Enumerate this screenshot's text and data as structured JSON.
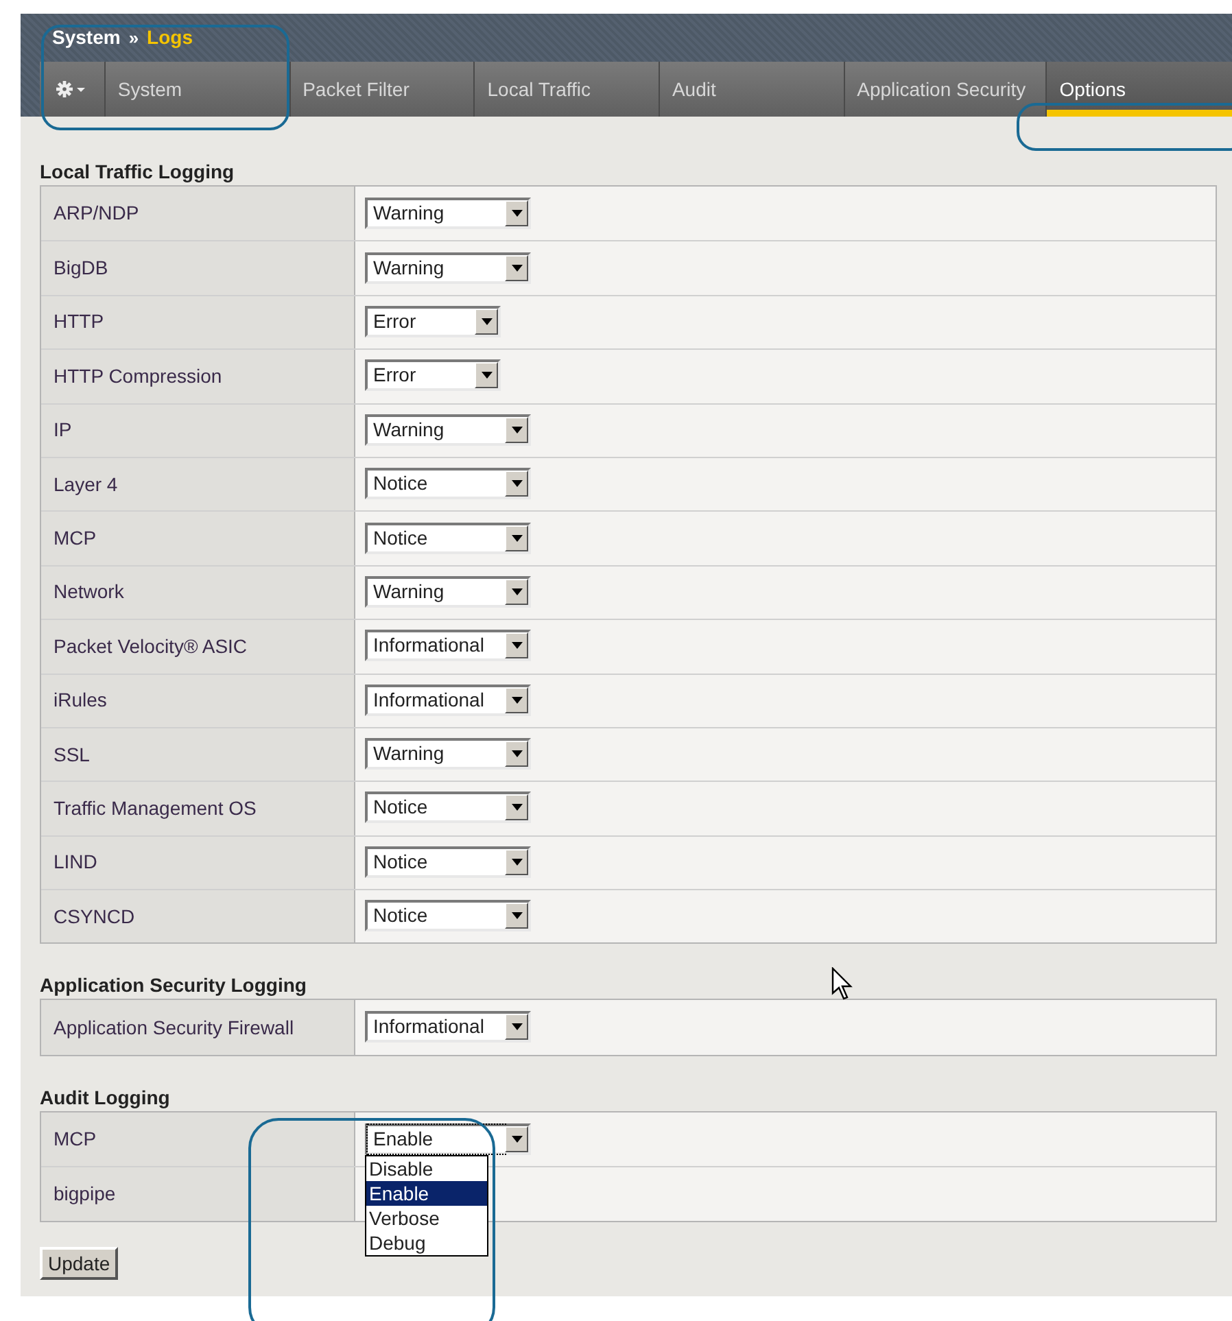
{
  "breadcrumb": {
    "parent": "System",
    "separator": "»",
    "current": "Logs"
  },
  "tabs": [
    {
      "label": "System",
      "selected": false
    },
    {
      "label": "Packet Filter",
      "selected": false
    },
    {
      "label": "Local Traffic",
      "selected": false
    },
    {
      "label": "Audit",
      "selected": false
    },
    {
      "label": "Application Security",
      "selected": false
    },
    {
      "label": "Options",
      "selected": true
    }
  ],
  "sections": [
    {
      "title": "Local Traffic Logging",
      "rows": [
        {
          "label": "ARP/NDP",
          "value": "Warning"
        },
        {
          "label": "BigDB",
          "value": "Warning"
        },
        {
          "label": "HTTP",
          "value": "Error"
        },
        {
          "label": "HTTP Compression",
          "value": "Error"
        },
        {
          "label": "IP",
          "value": "Warning"
        },
        {
          "label": "Layer 4",
          "value": "Notice"
        },
        {
          "label": "MCP",
          "value": "Notice"
        },
        {
          "label": "Network",
          "value": "Warning"
        },
        {
          "label": "Packet Velocity® ASIC",
          "value": "Informational"
        },
        {
          "label": "iRules",
          "value": "Informational"
        },
        {
          "label": "SSL",
          "value": "Warning"
        },
        {
          "label": "Traffic Management OS",
          "value": "Notice"
        },
        {
          "label": "LIND",
          "value": "Notice"
        },
        {
          "label": "CSYNCD",
          "value": "Notice"
        }
      ]
    },
    {
      "title": "Application Security Logging",
      "rows": [
        {
          "label": "Application Security Firewall",
          "value": "Informational"
        }
      ]
    },
    {
      "title": "Audit Logging",
      "rows": [
        {
          "label": "MCP",
          "value": "Enable",
          "expanded": true,
          "options": [
            {
              "label": "Disable",
              "selected": false
            },
            {
              "label": "Enable",
              "selected": true
            },
            {
              "label": "Verbose",
              "selected": false
            },
            {
              "label": "Debug",
              "selected": false
            }
          ]
        },
        {
          "label": "bigpipe"
        }
      ]
    }
  ],
  "button": "Update"
}
